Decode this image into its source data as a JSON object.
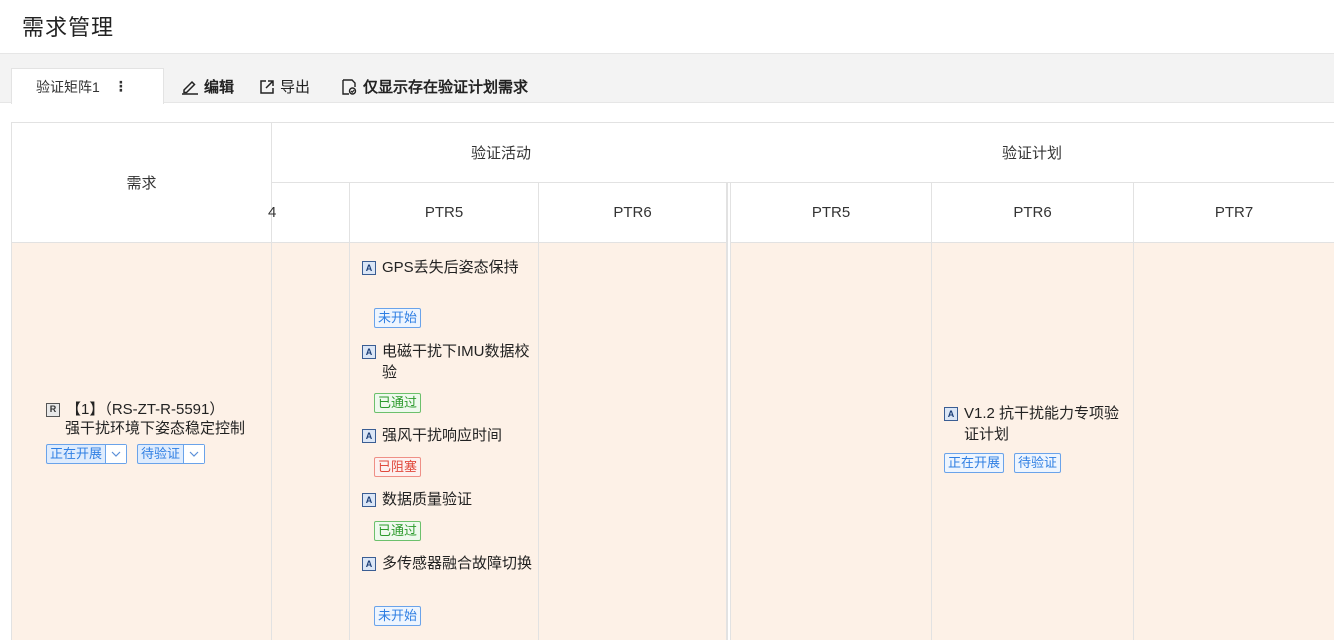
{
  "page": {
    "title": "需求管理"
  },
  "toolbar": {
    "tab_label": "验证矩阵1",
    "tab_menu": "⋮",
    "edit_label": "编辑",
    "export_label": "导出",
    "filter_label": "仅显示存在验证计划需求"
  },
  "table": {
    "requirement_header": "需求",
    "group_activity": "验证活动",
    "group_plan": "验证计划",
    "activity_columns": [
      "4",
      "PTR5",
      "PTR6"
    ],
    "plan_columns": [
      "PTR5",
      "PTR6",
      "PTR7"
    ],
    "requirement": {
      "type_icon": "R",
      "line1": "【1】（RS-ZT-R-5591）",
      "line2": "强干扰环境下姿态稳定控制",
      "status1": "正在开展",
      "status2": "待验证"
    },
    "activities": [
      {
        "icon": "A",
        "title": "GPS丢失后姿态保持",
        "status": "未开始",
        "tone": "blue"
      },
      {
        "icon": "A",
        "title": "电磁干扰下IMU数据校验",
        "status": "已通过",
        "tone": "green"
      },
      {
        "icon": "A",
        "title": "强风干扰响应时间",
        "status": "已阻塞",
        "tone": "red"
      },
      {
        "icon": "A",
        "title": "数据质量验证",
        "status": "已通过",
        "tone": "green"
      },
      {
        "icon": "A",
        "title": "多传感器融合故障切换",
        "status": "未开始",
        "tone": "blue"
      }
    ],
    "plan": {
      "icon": "A",
      "title": "V1.2 抗干扰能力专项验证计划",
      "status1": "正在开展",
      "status2": "待验证"
    }
  },
  "colors": {
    "row_bg": "#fdf1e7",
    "accent_blue": "#2f7fe3",
    "green": "#2c9a2c",
    "red": "#e0493c"
  }
}
